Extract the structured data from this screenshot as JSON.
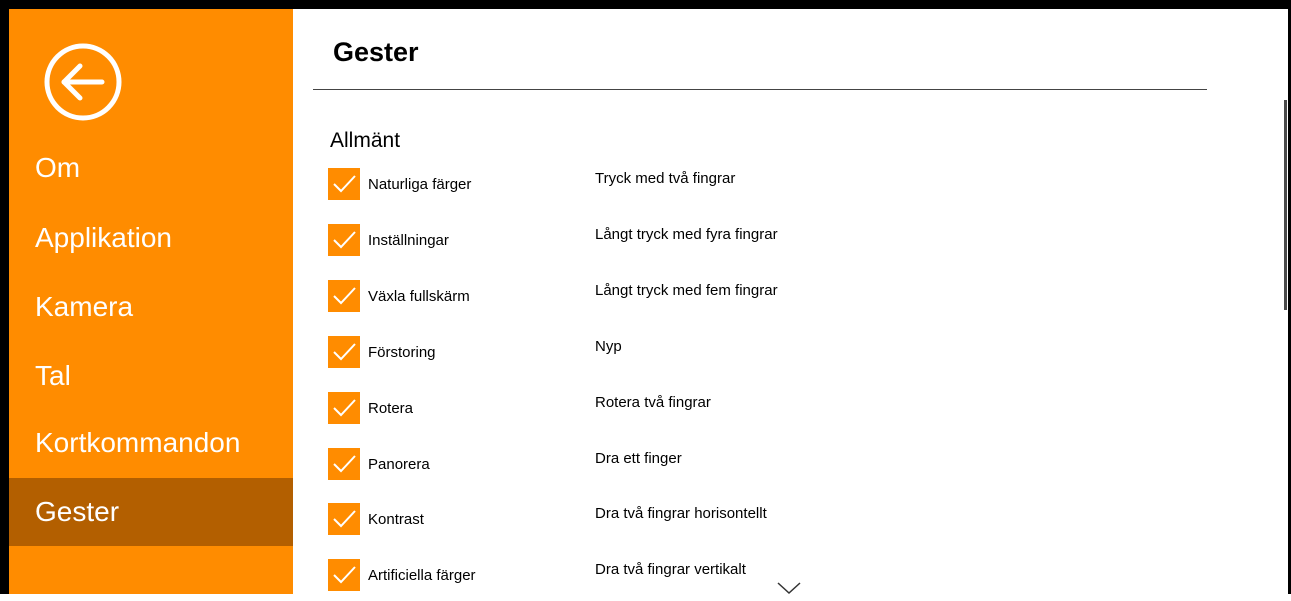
{
  "sidebar": {
    "back_icon": "back-arrow-circle-icon",
    "items": [
      {
        "label": "Om"
      },
      {
        "label": "Applikation"
      },
      {
        "label": "Kamera"
      },
      {
        "label": "Tal"
      },
      {
        "label": "Kortkommandon"
      },
      {
        "label": "Gester",
        "selected": true
      }
    ]
  },
  "main": {
    "title": "Gester",
    "section": "Allmänt",
    "rows": [
      {
        "label": "Naturliga färger",
        "gesture": "Tryck med två fingrar",
        "checked": true
      },
      {
        "label": "Inställningar",
        "gesture": "Långt tryck med fyra fingrar",
        "checked": true
      },
      {
        "label": "Växla fullskärm",
        "gesture": "Långt tryck med fem fingrar",
        "checked": true
      },
      {
        "label": "Förstoring",
        "gesture": "Nyp",
        "checked": true
      },
      {
        "label": "Rotera",
        "gesture": "Rotera två fingrar",
        "checked": true
      },
      {
        "label": "Panorera",
        "gesture": "Dra ett finger",
        "checked": true
      },
      {
        "label": "Kontrast",
        "gesture": "Dra två fingrar horisontellt",
        "checked": true
      },
      {
        "label": "Artificiella färger",
        "gesture": "Dra två fingrar vertikalt",
        "checked": true
      }
    ],
    "dropdown_icon": "chevron-down-icon"
  },
  "colors": {
    "accent": "#ff8c00",
    "selected": "#b35f00",
    "sidebar_text": "#ffffff"
  }
}
